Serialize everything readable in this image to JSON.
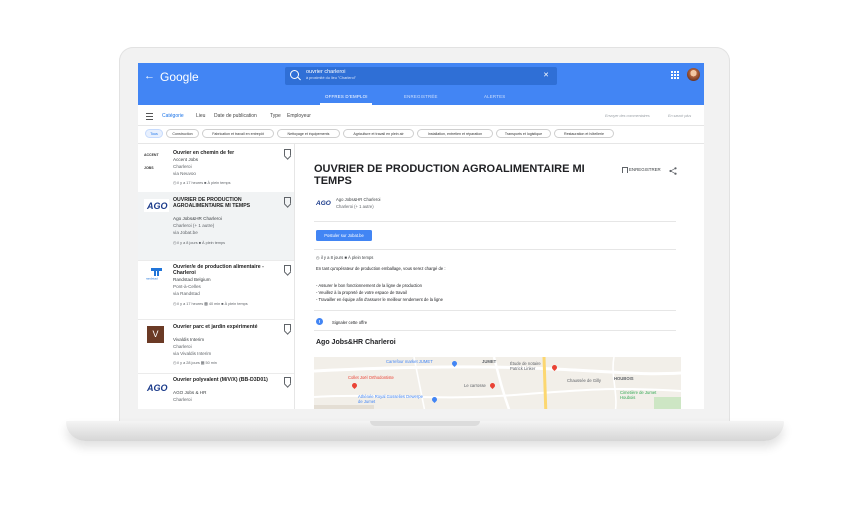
{
  "header": {
    "logo": "Google",
    "search_query": "ouvrier charleroi",
    "search_sub": "à proximité du lieu \"Charleroi\"",
    "tabs": [
      {
        "label": "OFFRES D'EMPLOI",
        "active": true
      },
      {
        "label": "ENREGISTRÉE",
        "active": false
      },
      {
        "label": "ALERTES",
        "active": false
      }
    ]
  },
  "filters": {
    "items": [
      "Catégorie",
      "Lieu",
      "Date de publication",
      "Type",
      "Employeur"
    ],
    "active_index": 0,
    "right_links": [
      "Envoyer des commentaires",
      "En savoir plus"
    ]
  },
  "chips": [
    "Tous",
    "Construction",
    "Fabrication et travail en entrepôt",
    "Nettoyage et équipements",
    "Agriculture et travail en plein air",
    "Installation, entretien et réparation",
    "Transports et logistique",
    "Restauration et hôtellerie"
  ],
  "jobs": [
    {
      "title": "Ouvrier en chemin de fer",
      "company": "Accent Jobs",
      "location": "Charleroi",
      "via": "via Neuvoo",
      "meta": "il y a 17 heures",
      "type": "À plein temps",
      "logo": "ACCENT JOBS"
    },
    {
      "title": "OUVRIER DE PRODUCTION AGROALIMENTAIRE MI TEMPS",
      "company": "Ago Jobs&HR Charleroi",
      "location": "Charleroi (+ 1 autre)",
      "via": "via Jobat.be",
      "meta": "il y a 8 jours",
      "type": "À plein temps",
      "logo": "AGO"
    },
    {
      "title": "Ouvrier/e de production alimentaire - Charleroi",
      "company": "Randstad Belgium",
      "location": "Pont-à-Celles",
      "via": "via Randstad",
      "meta": "il y a 17 heures",
      "commute": "40 min",
      "type": "À plein temps",
      "logo": "randstad"
    },
    {
      "title": "Ouvrier parc et jardin expérimenté",
      "company": "Vivaldis Interim",
      "location": "Charleroi",
      "via": "via Vivaldis Interim",
      "meta": "il y a 28 jours",
      "commute": "50 min",
      "logo": "V"
    },
    {
      "title": "Ouvrier polyvalent (M/V/X) (BB-D3D01)",
      "company": "AGO Jobs & HR",
      "location": "Charleroi",
      "via": "",
      "logo": "AGO"
    }
  ],
  "detail": {
    "title": "OUVRIER DE PRODUCTION AGROALIMENTAIRE MI TEMPS",
    "save_label": "ENREGISTRER",
    "company": "Ago Jobs&HR Charleroi",
    "location": "Charleroi (+ 1 autre)",
    "apply_label": "Postuler sur Jobat.be",
    "meta": "il y a 8 jours",
    "type": "À plein temps",
    "description": [
      "En tant qu'opérateur de production emballage, vous serez chargé de :",
      "",
      "- Assurer le bon fonctionnement de la ligne de production",
      "- Veuillez à la propreté de votre espace de travail",
      "- Travailler en équipe afin d'assurer le meilleur rendement de la ligne"
    ],
    "report_label": "Signaler cette offre",
    "employer_heading": "Ago Jobs&HR Charleroi",
    "map_labels": [
      "Carrefour market JUMET",
      "JUMET",
      "Étude de notaire Patrick Linker",
      "Collet Joël Orthodontiste",
      "Le carrosse",
      "Chaussée de Gilly",
      "HOUBOIS",
      "Athénée Royal Gosselies Dewerpe de Jumet",
      "Cimetière de Jumet Houbois"
    ]
  },
  "colors": {
    "brand_blue": "#4285f4",
    "link_blue": "#1a73e8"
  }
}
